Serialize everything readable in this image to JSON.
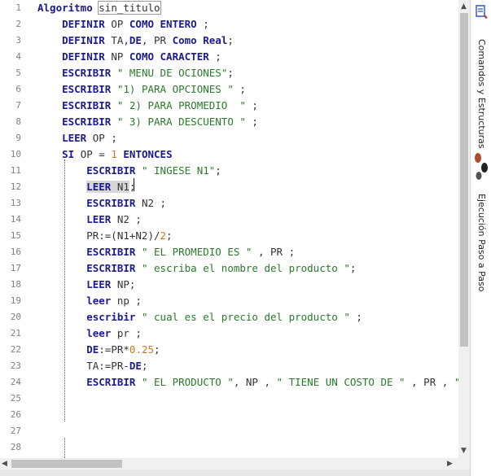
{
  "editor": {
    "lines": [
      {
        "n": "1",
        "parts": [
          [
            "kw",
            "Algoritmo"
          ],
          [
            "plain",
            " "
          ],
          [
            "boxed",
            "sin_titulo"
          ]
        ]
      },
      {
        "n": "2",
        "parts": [
          [
            "plain",
            "    "
          ],
          [
            "kw",
            "DEFINIR"
          ],
          [
            "plain",
            " OP "
          ],
          [
            "kw",
            "COMO ENTERO"
          ],
          [
            "plain",
            " ;"
          ]
        ]
      },
      {
        "n": "3",
        "parts": [
          [
            "plain",
            "    "
          ],
          [
            "kw",
            "DEFINIR"
          ],
          [
            "plain",
            " TA,"
          ],
          [
            "kw",
            "DE"
          ],
          [
            "plain",
            ", PR "
          ],
          [
            "kw",
            "Como Real"
          ],
          [
            "plain",
            ";"
          ]
        ]
      },
      {
        "n": "4",
        "parts": [
          [
            "plain",
            "    "
          ],
          [
            "kw",
            "DEFINIR"
          ],
          [
            "plain",
            " NP "
          ],
          [
            "kw",
            "COMO CARACTER"
          ],
          [
            "plain",
            " ;"
          ]
        ]
      },
      {
        "n": "5",
        "parts": [
          [
            "plain",
            "    "
          ],
          [
            "kw",
            "ESCRIBIR"
          ],
          [
            "plain",
            " "
          ],
          [
            "str",
            "\" MENU DE OCIONES\""
          ],
          [
            "plain",
            ";"
          ]
        ]
      },
      {
        "n": "6",
        "parts": [
          [
            "plain",
            "    "
          ],
          [
            "kw",
            "ESCRIBIR"
          ],
          [
            "plain",
            " "
          ],
          [
            "str",
            "\"1) PARA OPCIONES \""
          ],
          [
            "plain",
            " ;"
          ]
        ]
      },
      {
        "n": "7",
        "parts": [
          [
            "plain",
            "    "
          ],
          [
            "kw",
            "ESCRIBIR"
          ],
          [
            "plain",
            " "
          ],
          [
            "str",
            "\" 2) PARA PROMEDIO  \""
          ],
          [
            "plain",
            " ;"
          ]
        ]
      },
      {
        "n": "8",
        "parts": [
          [
            "plain",
            "    "
          ],
          [
            "kw",
            "ESCRIBIR"
          ],
          [
            "plain",
            " "
          ],
          [
            "str",
            "\" 3) PARA DESCUENTO \""
          ],
          [
            "plain",
            " ;"
          ]
        ]
      },
      {
        "n": "9",
        "parts": [
          [
            "plain",
            "    "
          ],
          [
            "kw",
            "LEER"
          ],
          [
            "plain",
            " OP ;"
          ]
        ]
      },
      {
        "n": "10",
        "parts": [
          [
            "plain",
            "    "
          ],
          [
            "kw",
            "SI"
          ],
          [
            "plain",
            " OP = "
          ],
          [
            "num",
            "1"
          ],
          [
            "plain",
            " "
          ],
          [
            "kw",
            "ENTONCES"
          ]
        ]
      },
      {
        "n": "11",
        "parts": [
          [
            "plain",
            "        "
          ],
          [
            "kw",
            "ESCRIBIR"
          ],
          [
            "plain",
            " "
          ],
          [
            "str",
            "\" INGESE N1\""
          ],
          [
            "plain",
            ";"
          ]
        ]
      },
      {
        "n": "12",
        "parts": [
          [
            "plain",
            "        "
          ],
          [
            "hlkw",
            "LEER"
          ],
          [
            "hl",
            " N1"
          ],
          [
            "plain",
            ";"
          ]
        ]
      },
      {
        "n": "13",
        "parts": [
          [
            "plain",
            "        "
          ],
          [
            "kw",
            "ESCRIBIR"
          ],
          [
            "plain",
            " N2 ;"
          ]
        ]
      },
      {
        "n": "14",
        "parts": [
          [
            "plain",
            "        "
          ],
          [
            "kw",
            "LEER"
          ],
          [
            "plain",
            " N2 ;"
          ]
        ]
      },
      {
        "n": "15",
        "parts": [
          [
            "plain",
            "        PR:=(N1+N2)/"
          ],
          [
            "num",
            "2"
          ],
          [
            "plain",
            ";"
          ]
        ]
      },
      {
        "n": "16",
        "parts": [
          [
            "plain",
            "        "
          ],
          [
            "kw",
            "ESCRIBIR"
          ],
          [
            "plain",
            " "
          ],
          [
            "str",
            "\" EL PROMEDIO ES \""
          ],
          [
            "plain",
            " , PR ;"
          ]
        ]
      },
      {
        "n": "17",
        "parts": [
          [
            "plain",
            "        "
          ],
          [
            "kw",
            "ESCRIBIR"
          ],
          [
            "plain",
            " "
          ],
          [
            "str",
            "\" escriba el nombre del producto \""
          ],
          [
            "plain",
            ";"
          ]
        ]
      },
      {
        "n": "18",
        "parts": [
          [
            "plain",
            "        "
          ],
          [
            "kw",
            "LEER"
          ],
          [
            "plain",
            " NP;"
          ]
        ]
      },
      {
        "n": "19",
        "parts": [
          [
            "plain",
            "        "
          ],
          [
            "kw",
            "leer"
          ],
          [
            "plain",
            " np ;"
          ]
        ]
      },
      {
        "n": "20",
        "parts": [
          [
            "plain",
            "        "
          ],
          [
            "kw",
            "escribir"
          ],
          [
            "plain",
            " "
          ],
          [
            "str",
            "\" cual es el precio del producto \""
          ],
          [
            "plain",
            " ;"
          ]
        ]
      },
      {
        "n": "21",
        "parts": [
          [
            "plain",
            "        "
          ],
          [
            "kw",
            "leer"
          ],
          [
            "plain",
            " pr ;"
          ]
        ]
      },
      {
        "n": "22",
        "parts": [
          [
            "plain",
            "        "
          ],
          [
            "kw",
            "DE"
          ],
          [
            "plain",
            ":=PR*"
          ],
          [
            "num",
            "0.25"
          ],
          [
            "plain",
            ";"
          ]
        ]
      },
      {
        "n": "23",
        "parts": [
          [
            "plain",
            "        TA:=PR-"
          ],
          [
            "kw",
            "DE"
          ],
          [
            "plain",
            ";"
          ]
        ]
      },
      {
        "n": "24",
        "parts": [
          [
            "plain",
            "        "
          ],
          [
            "kw",
            "ESCRIBIR"
          ],
          [
            "plain",
            " "
          ],
          [
            "str",
            "\" EL PRODUCTO \""
          ],
          [
            "plain",
            ", NP , "
          ],
          [
            "str",
            "\" TIENE UN COSTO DE \""
          ],
          [
            "plain",
            " , PR , "
          ],
          [
            "str",
            "\" CO"
          ]
        ]
      },
      {
        "n": "25",
        "parts": []
      },
      {
        "n": "26",
        "parts": []
      },
      {
        "n": "27",
        "parts": []
      },
      {
        "n": "28",
        "parts": []
      }
    ]
  },
  "sidebar": {
    "panel1_label": "Comandos y Estructuras",
    "panel2_label": "Ejecución Paso a Paso"
  },
  "scrollbar": {
    "up_arrow": "▲",
    "down_arrow": "▼",
    "left_arrow": "◀",
    "right_arrow": "▶"
  },
  "colors": {
    "keyword": "#1a1a8c",
    "string": "#2a7a2a",
    "number": "#c8781e"
  }
}
